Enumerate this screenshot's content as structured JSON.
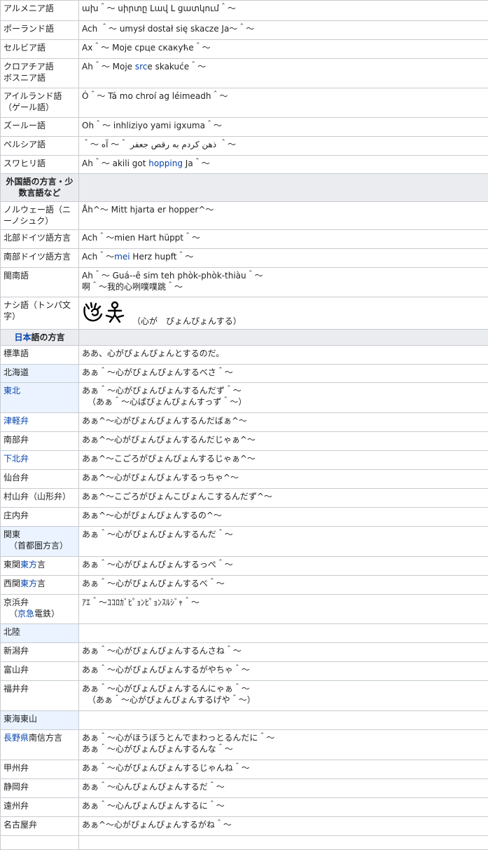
{
  "colors": {
    "link": "#0645ad",
    "section_bg": "#eaecf0",
    "sub_bg": "#eaf3ff",
    "border": "#c8ccd1"
  },
  "rows": [
    {
      "lang": "アルメニア語",
      "text": [
        "ախ＾～ սիրտը Լավ Լ ցատկում＾～"
      ]
    },
    {
      "lang": "ポーランド語",
      "text": [
        "Ach ＾～ umysł dostał się skacze Ja～＾～"
      ]
    },
    {
      "lang": "セルビア語",
      "text": [
        "Ах＾～ Моје срце скакуће＾～"
      ]
    },
    {
      "lang": "クロアチア語\nボスニア語",
      "text": [
        "Ah＾～ Moje ",
        "src",
        "e skakuće＾～"
      ]
    },
    {
      "lang": "アイルランド語（ゲール語）",
      "text": [
        "Ó＾～ Tá mo chroí ag léimeadh＾～"
      ]
    },
    {
      "lang": "ズールー語",
      "text": [
        "Oh＾～ inhliziyo yami igxuma＾～"
      ]
    },
    {
      "lang": "ペルシア語",
      "text": [
        "＾～ ذهن کردم به رقص جعفر ＾～ آه ＾～"
      ]
    },
    {
      "lang": "スワヒリ語",
      "text": [
        "Ah＾～ akili got ",
        "hopping",
        " Ja＾～"
      ]
    }
  ],
  "section1": {
    "label": "外国語の方言・少数言語など"
  },
  "rows2": [
    {
      "lang": "ノルウェー語（ニーノシュク）",
      "text": "Åh^～ Mitt hjarta er hopper^～"
    },
    {
      "lang": "北部ドイツ語方言",
      "text": "Ach＾～mien Hart hüppt＾～"
    },
    {
      "lang": "南部ドイツ語方言",
      "pre": "Ach＾～",
      "link": "mei",
      "post": " Herz hupft＾～"
    },
    {
      "lang": "閩南語",
      "line1": "Ah＾～ Guá--ê sim teh phòk-phòk-thiàu＾～",
      "line2": "啊＾～我的心咧噗噗跳＾～"
    }
  ],
  "naxi": {
    "lang": "ナシ語（トンパ文字）",
    "text": "（心が　ぴょんぴょんする）"
  },
  "section2": {
    "link": "日本",
    "label": "語の方言"
  },
  "rows3": [
    {
      "lang": "標準語",
      "text": "ああ、心がぴょんぴょんとするのだ。"
    },
    {
      "lang": "北海道",
      "text": "あぁ＾～心がぴょんぴょんするべさ＾～"
    },
    {
      "lang": "東北",
      "line1": "あぁ＾～心がぴょんぴょんするんだず＾～",
      "line2": "（あぁ＾～心ぱぴょんぴょんすっず＾～）"
    },
    {
      "lang": "津軽弁",
      "text": "あぁ^～心がぴょんぴょんするんだばぁ^～"
    },
    {
      "lang": "南部弁",
      "text": "あぁ^～心がぴょんぴょんするんだじゃぁ^～"
    },
    {
      "lang": "下北弁",
      "text": "あぁ^～こごろがぴょんぴょんするじゃぁ^～"
    },
    {
      "lang": "仙台弁",
      "text": "あぁ^～心がぴょんぴょんするっちゃ^～"
    },
    {
      "lang": "村山弁（山形弁）",
      "text": "あぁ^～こごろがぴょんこぴょんこするんだず^～"
    },
    {
      "lang": "庄内弁",
      "text": "あぁ^～心がぴょんぴょんするの^～"
    },
    {
      "lang1": "関東",
      "lang2": "（首都圏方言）",
      "text": "あぁ＾～心がぴょんぴょんするんだ＾～"
    },
    {
      "pre": "東関",
      "link": "東方",
      "post": "言",
      "text": "あぁ＾～心がぴょんぴょんするっぺ＾～"
    },
    {
      "pre": "西関",
      "link": "東方",
      "post": "言",
      "text": "あぁ＾～心がぴょんぴょんするべ＾～"
    },
    {
      "lang1": "京浜弁",
      "link": "京急",
      "post": "電鉄）",
      "text": "ｱｴ＾～ｺｺﾛｶﾞﾋﾟｮﾝﾋﾟｮﾝｽﾙｼﾞｬ＾～"
    },
    {
      "lang": "北陸",
      "text": ""
    },
    {
      "lang": "新潟弁",
      "text": "あぁ＾～心がぴょんぴょんするんさね＾～"
    },
    {
      "lang": "富山弁",
      "text": "あぁ＾～心がぴょんぴょんするがやちゃ＾～"
    },
    {
      "lang": "福井弁",
      "line1": "あぁ＾～心がぴょんぴょんするんにゃぁ＾～",
      "line2": "（あぁ＾～心がぴょんぴょんするげや＾～）"
    },
    {
      "lang": "東海東山",
      "text": ""
    },
    {
      "link": "長野県",
      "post": "南信方言",
      "line1": "あぁ＾～心がほうぼうとんでまわっとるんだに＾～",
      "line2": "あぁ＾～心がぴょんぴょんするんな＾～"
    },
    {
      "lang": "甲州弁",
      "text": "あぁ＾～心がぴょんぴょんするじゃんね＾～"
    },
    {
      "lang": "静岡弁",
      "text": "あぁ＾～心んぴょんぴょんするだ＾～"
    },
    {
      "lang": "遠州弁",
      "text": "あぁ＾～心んぴょんぴょんするに＾～"
    },
    {
      "lang": "名古屋弁",
      "text": "あぁ^～心がぴょんぴょんするがね＾～"
    }
  ]
}
